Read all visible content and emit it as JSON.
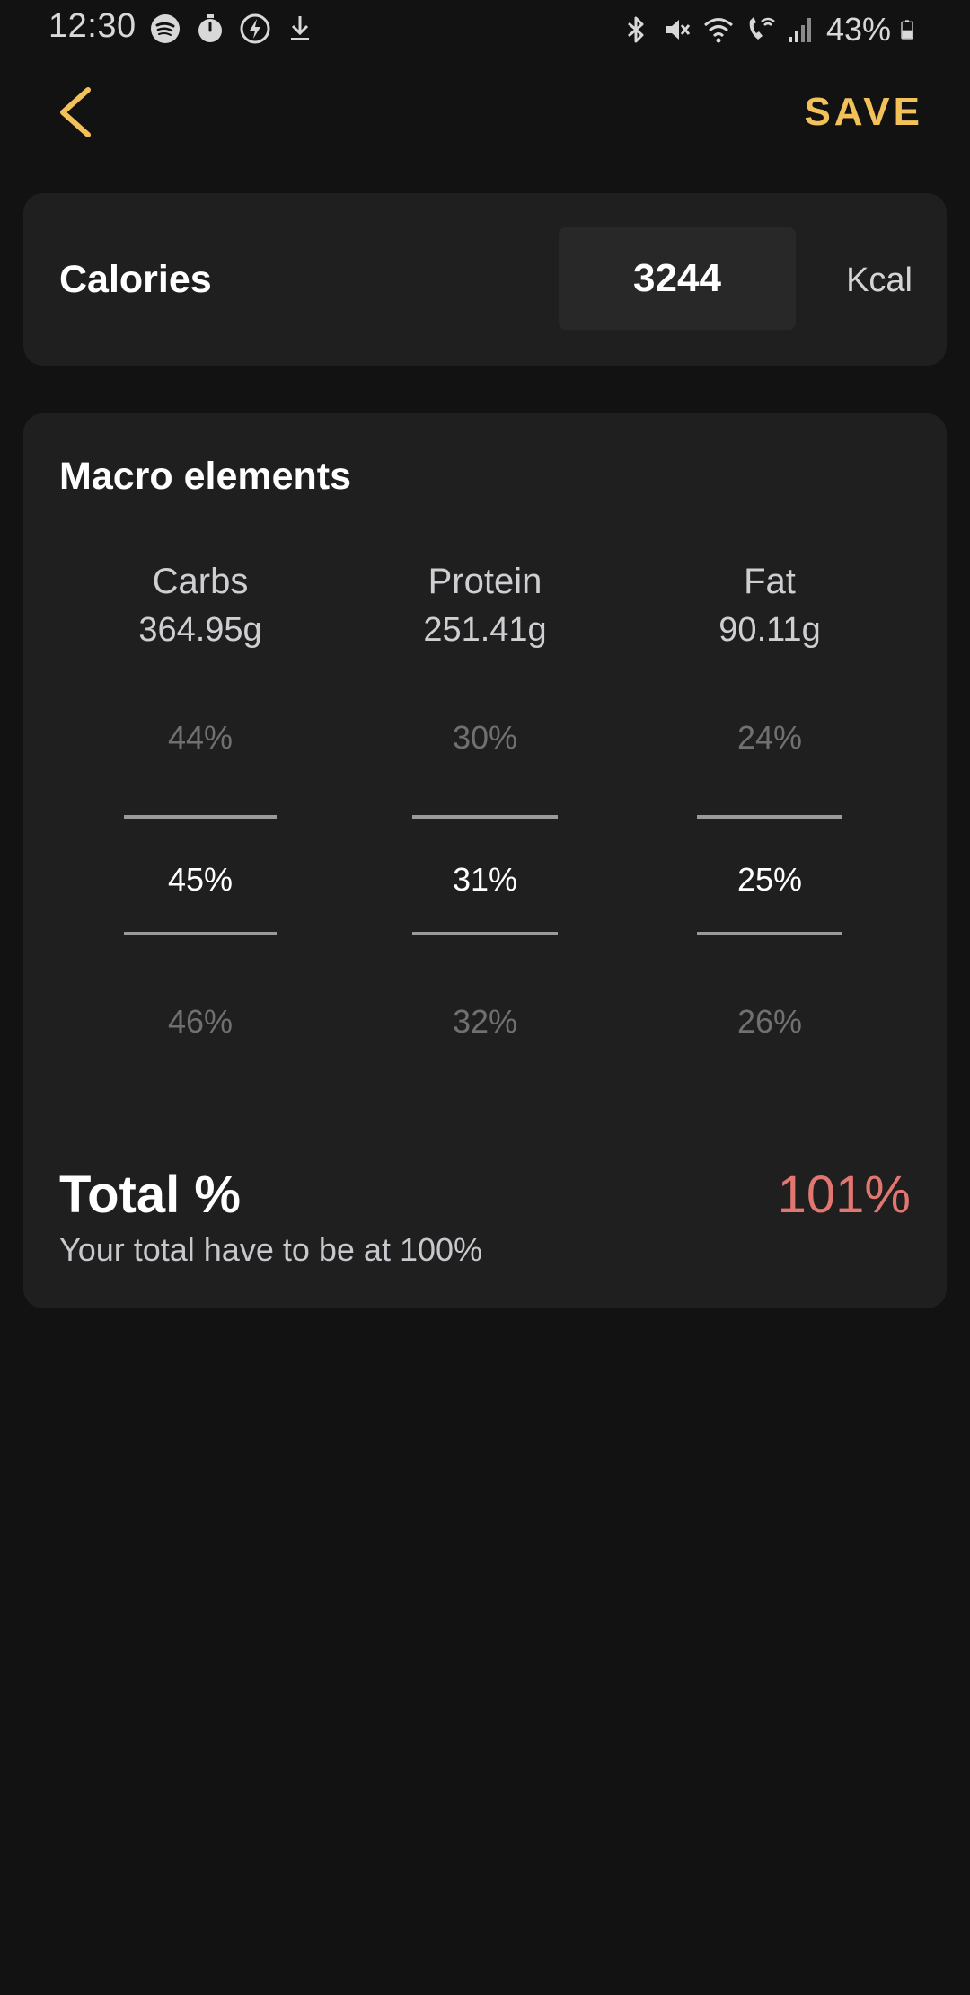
{
  "status_bar": {
    "time": "12:30",
    "battery": "43%",
    "left_icons": [
      "spotify-icon",
      "stopwatch-icon",
      "flash-icon",
      "download-icon"
    ],
    "right_icons": [
      "bluetooth-icon",
      "vibrate-mute-icon",
      "wifi-icon",
      "wifi-calling-icon",
      "signal-icon",
      "battery-icon"
    ]
  },
  "header": {
    "back_icon": "chevron-left-icon",
    "save_label": "SAVE"
  },
  "calories": {
    "label": "Calories",
    "value": "3244",
    "unit": "Kcal"
  },
  "macros": {
    "title": "Macro elements",
    "items": [
      {
        "name": "Carbs",
        "grams": "364.95g",
        "above": "44%",
        "selected": "45%",
        "below": "46%"
      },
      {
        "name": "Protein",
        "grams": "251.41g",
        "above": "30%",
        "selected": "31%",
        "below": "32%"
      },
      {
        "name": "Fat",
        "grams": "90.11g",
        "above": "24%",
        "selected": "25%",
        "below": "26%"
      }
    ]
  },
  "total": {
    "label": "Total %",
    "hint": "Your total have to be at 100%",
    "value": "101%"
  },
  "colors": {
    "accent": "#f3c15a",
    "error": "#e27670",
    "background": "#121212",
    "card": "#1f1f1f"
  }
}
